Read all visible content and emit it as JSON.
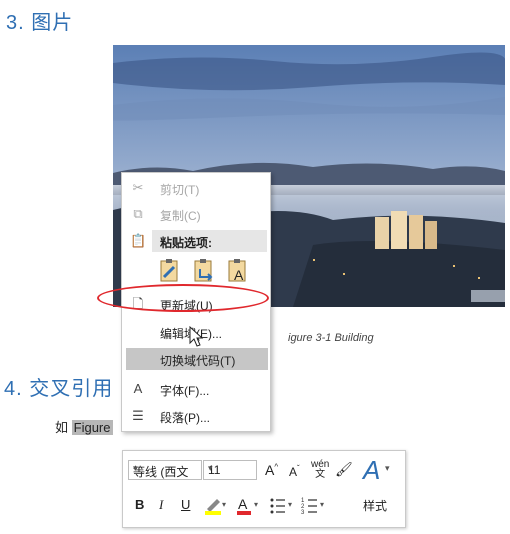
{
  "headings": {
    "section3": "3. 图片",
    "section4": "4. 交叉引用"
  },
  "caption": "igure 3-1 Building",
  "body": {
    "prefix": "如",
    "selected": "Figure"
  },
  "context_menu": {
    "cut": "剪切(T)",
    "copy": "复制(C)",
    "paste_options": "粘贴选项:",
    "update_field": "更新域(U)",
    "edit_field": "编辑域(E)...",
    "toggle_field_codes": "切换域代码(T)",
    "font": "字体(F)...",
    "paragraph": "段落(P)..."
  },
  "toolbar": {
    "font_name": "等线 (西文",
    "font_size": "11",
    "grow_font": "A",
    "shrink_font": "A",
    "phonetic": "wén",
    "bold": "B",
    "italic": "I",
    "underline": "U",
    "font_color_letter": "A",
    "styles": "样式"
  },
  "icons": [
    "scissors-icon",
    "copy-icon",
    "clipboard-icon",
    "paste-keep-format-icon",
    "paste-merge-icon",
    "paste-text-only-icon",
    "update-field-icon",
    "font-icon",
    "paragraph-icon",
    "mouse-cursor-icon",
    "format-painter-icon",
    "highlighter-icon",
    "bullets-icon",
    "numbering-icon",
    "styles-icon"
  ],
  "colors": {
    "heading": "#2f6fb3",
    "annotation_ellipse": "#e0282d",
    "font_color_bar": "#e0282d",
    "highlight_bar": "#ffff00"
  }
}
